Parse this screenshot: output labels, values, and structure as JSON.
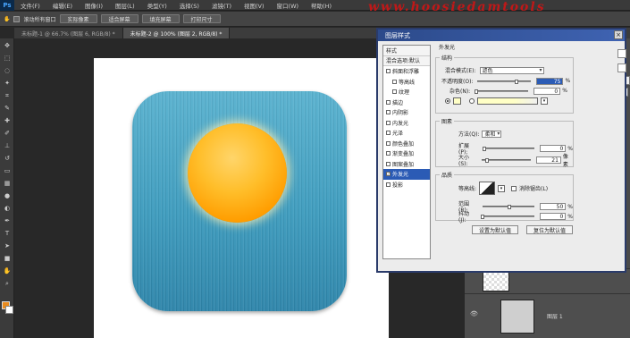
{
  "menubar": {
    "items": [
      "文件(F)",
      "编辑(E)",
      "图像(I)",
      "图层(L)",
      "类型(Y)",
      "选择(S)",
      "滤镜(T)",
      "视图(V)",
      "窗口(W)",
      "帮助(H)"
    ]
  },
  "watermark": "www.hoosiedamtools",
  "optbar": {
    "scroll_all_label": "滚动所有窗口",
    "actual_pixels": "实际像素",
    "fit_screen": "适合屏幕",
    "fill_screen": "填充屏幕",
    "print_size": "打印尺寸"
  },
  "tabs": [
    {
      "label": "未标题-1 @ 66.7% (图层 6, RGB/8) *",
      "active": false
    },
    {
      "label": "未标题-2 @ 100% (图层 2, RGB/8) *",
      "active": true
    }
  ],
  "dialog": {
    "title": "图层样式",
    "close": "×",
    "styles_header": "样式",
    "blend_options": "混合选项:默认",
    "styles": [
      {
        "label": "斜面和浮雕",
        "indent": false,
        "selected": false
      },
      {
        "label": "等高线",
        "indent": true,
        "selected": false
      },
      {
        "label": "纹理",
        "indent": true,
        "selected": false
      },
      {
        "label": "描边",
        "indent": false,
        "selected": false
      },
      {
        "label": "内阴影",
        "indent": false,
        "selected": false
      },
      {
        "label": "内发光",
        "indent": false,
        "selected": false
      },
      {
        "label": "光泽",
        "indent": false,
        "selected": false
      },
      {
        "label": "颜色叠加",
        "indent": false,
        "selected": false
      },
      {
        "label": "渐变叠加",
        "indent": false,
        "selected": false
      },
      {
        "label": "图案叠加",
        "indent": false,
        "selected": false
      },
      {
        "label": "外发光",
        "indent": false,
        "selected": true
      },
      {
        "label": "投影",
        "indent": false,
        "selected": false
      }
    ],
    "panel_title": "外发光",
    "structure": {
      "title": "结构",
      "blend_mode_label": "混合模式(E):",
      "blend_mode_value": "滤色",
      "opacity_label": "不透明度(O):",
      "opacity_value": "75",
      "opacity_pct": 0.75,
      "noise_label": "杂色(N):",
      "noise_value": "0",
      "noise_pct": 0.0,
      "unit_percent": "%"
    },
    "elements": {
      "title": "图素",
      "technique_label": "方法(Q):",
      "technique_value": "柔和",
      "spread_label": "扩展(P):",
      "spread_value": "0",
      "spread_pct": 0.0,
      "size_label": "大小(S):",
      "size_value": "21",
      "size_pct": 0.08,
      "unit_px": "像素"
    },
    "quality": {
      "title": "品质",
      "contour_label": "等高线:",
      "antialias_label": "消除锯齿(L)",
      "range_label": "范围(R):",
      "range_value": "50",
      "range_pct": 0.5,
      "jitter_label": "抖动(J):",
      "jitter_value": "0",
      "jitter_pct": 0.0
    },
    "make_default": "设置为默认值",
    "reset_default": "复位为默认值"
  },
  "layers": {
    "layer1_name": "图层 1"
  },
  "right_buttons": [
    "新"
  ],
  "colors": {
    "accent": "#2b5bb5",
    "icon_blue": "#3e9cbe",
    "sun_orange": "#ffbe2a",
    "foreground": "#e98b1e",
    "background": "#ffffff"
  }
}
